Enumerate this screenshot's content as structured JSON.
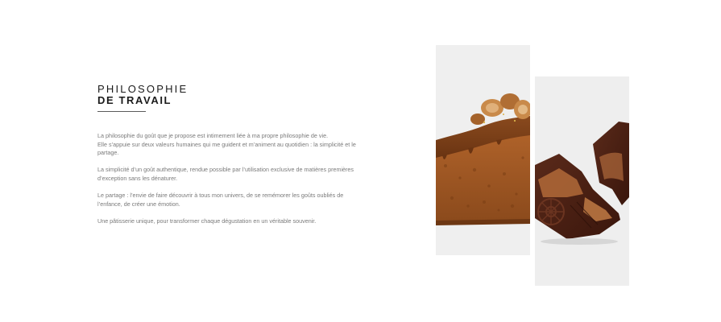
{
  "section": {
    "title_line1": "PHILOSOPHIE",
    "title_line2": "DE TRAVAIL"
  },
  "paragraphs": [
    {
      "lines": [
        "La philosophie du goût que je propose est intimement liée à ma propre philosophie de vie.",
        "Elle s’appuie sur deux valeurs humaines qui me guident et m’animent au quotidien : la simplicité et le",
        "partage."
      ]
    },
    {
      "lines": [
        "La simplicité d’un goût authentique, rendue possible par l’utilisation exclusive de matières premières",
        "d’exception sans les dénaturer."
      ]
    },
    {
      "lines": [
        "Le partage : l’envie de faire découvrir à tous mon univers, de se remémorer les goûts oubliés de",
        "l’enfance, de créer une émotion."
      ]
    },
    {
      "lines": [
        "Une pâtisserie unique, pour transformer chaque dégustation en un véritable souvenir."
      ]
    }
  ],
  "images": {
    "left": "hazelnut-caramel-cake-photo",
    "right": "chocolate-bar-photo"
  },
  "colors": {
    "heading": "#1b1b1b",
    "body_text": "#7a7a7a",
    "divider": "#5b5b5b",
    "photo_background": "#efefef"
  }
}
